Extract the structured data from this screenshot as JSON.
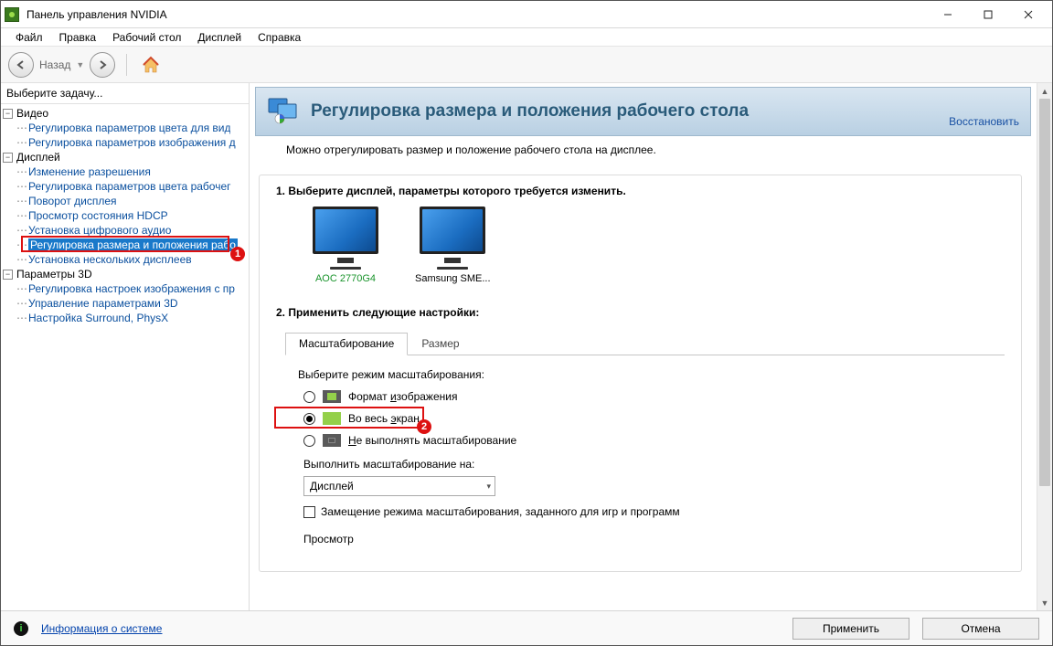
{
  "titlebar": {
    "title": "Панель управления NVIDIA"
  },
  "menu": {
    "file": "Файл",
    "edit": "Правка",
    "desktop": "Рабочий стол",
    "display": "Дисплей",
    "help": "Справка"
  },
  "nav": {
    "back": "Назад"
  },
  "sidebar": {
    "header": "Выберите задачу...",
    "cat_video": "Видео",
    "video_items": [
      "Регулировка параметров цвета для вид",
      "Регулировка параметров изображения д"
    ],
    "cat_display": "Дисплей",
    "display_items": [
      "Изменение разрешения",
      "Регулировка параметров цвета рабочег",
      "Поворот дисплея",
      "Просмотр состояния HDCP",
      "Установка цифрового аудио",
      "Регулировка размера и положения рабо",
      "Установка нескольких дисплеев"
    ],
    "cat_3d": "Параметры 3D",
    "three_d_items": [
      "Регулировка настроек изображения с пр",
      "Управление параметрами 3D",
      "Настройка Surround, PhysX"
    ]
  },
  "page": {
    "title": "Регулировка размера и положения рабочего стола",
    "restore": "Восстановить",
    "lead": "Можно отрегулировать размер и положение рабочего стола на дисплее.",
    "step1": "1. Выберите дисплей, параметры которого требуется изменить.",
    "displays": [
      {
        "name": "AOC 2770G4"
      },
      {
        "name": "Samsung SME..."
      }
    ],
    "step2": "2. Применить следующие настройки:",
    "tabs": {
      "scaling": "Масштабирование",
      "size": "Размер"
    },
    "scaling": {
      "choose_mode": "Выберите режим масштабирования:",
      "opt_aspect_pre": "Формат ",
      "opt_aspect_u": "и",
      "opt_aspect_post": "зображения",
      "opt_full_pre": "Во весь ",
      "opt_full_u": "э",
      "opt_full_post": "кран",
      "opt_none_u": "Н",
      "opt_none_post": "е выполнять масштабирование",
      "perform_on": "Выполнить масштабирование на:",
      "perform_value": "Дисплей",
      "override": "Замещение режима масштабирования, заданного для игр и программ",
      "preview": "Просмотр"
    }
  },
  "footer": {
    "sysinfo": "Информация о системе",
    "apply": "Применить",
    "cancel": "Отмена"
  },
  "badges": {
    "one": "1",
    "two": "2"
  }
}
